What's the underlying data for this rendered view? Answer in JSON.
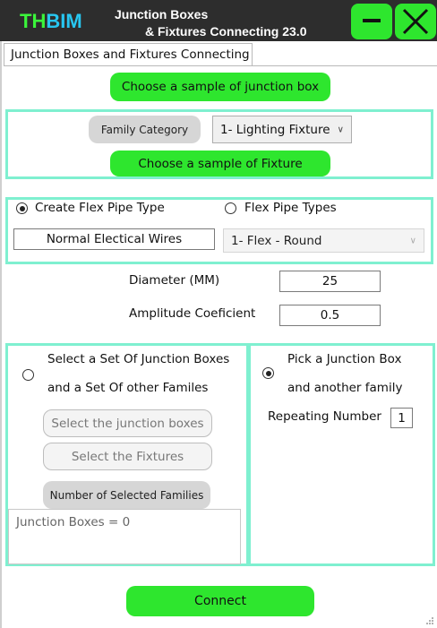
{
  "titlebar": {
    "logo_a": "TH",
    "logo_b": "BIM",
    "title_line1": "Junction Boxes",
    "title_line2": "& Fixtures Connecting 23.0",
    "minimize_icon": "minus-icon",
    "close_icon": "x-icon",
    "accent": "#2ee62e"
  },
  "tab": {
    "label": "Junction Boxes and Fixtures Connecting"
  },
  "junction_sample_button": "Choose a sample of junction box",
  "fixture_panel": {
    "family_category_label": "Family Category",
    "family_category_value": "1- Lighting Fixture",
    "choose_fixture_button": "Choose a sample of Fixture"
  },
  "flex_panel": {
    "create_radio_label": "Create Flex Pipe Type",
    "types_radio_label": "Flex Pipe Types",
    "name_value": "Normal Electical Wires",
    "type_value": "1- Flex - Round"
  },
  "params": {
    "diameter_label": "Diameter (MM)",
    "diameter_value": "25",
    "amplitude_label": "Amplitude Coeficient",
    "amplitude_value": "0.5"
  },
  "set_panel": {
    "line1": "Select a Set Of Junction Boxes",
    "line2": "and a Set Of other Familes",
    "select_boxes_button": "Select the junction boxes",
    "select_fixtures_button": "Select the Fixtures",
    "count_button": "Number of Selected Families",
    "result_text": "Junction Boxes = 0"
  },
  "pick_panel": {
    "line1": "Pick a Junction Box",
    "line2": "and another family",
    "repeat_label": "Repeating Number",
    "repeat_value": "1"
  },
  "connect_button": "Connect",
  "colors": {
    "panel_border": "#7ff0d0",
    "green": "#2ee62e",
    "titlebar": "#2d2d2d"
  }
}
